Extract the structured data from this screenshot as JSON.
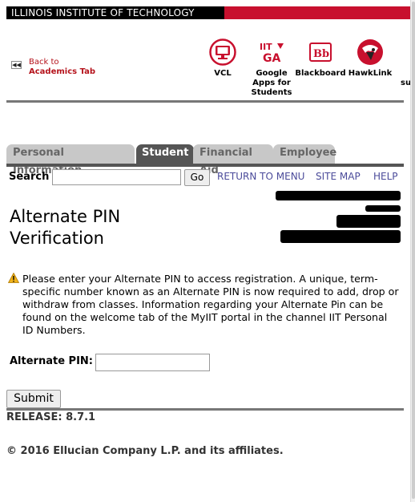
{
  "banner": {
    "title": "ILLINOIS INSTITUTE OF TECHNOLOGY",
    "black": "#000000",
    "red": "#c8102e"
  },
  "back_link": {
    "line1": "Back to",
    "line2": "Academics Tab",
    "icon": "back-arrow-icon"
  },
  "quick_links": [
    {
      "label": "VCL",
      "icon": "monitor-icon"
    },
    {
      "label": "Google Apps for Students",
      "line1": "Google",
      "line2": "Apps for",
      "line3": "Students",
      "icon": "iit-ga-logo-icon"
    },
    {
      "label": "Blackboard",
      "icon": "blackboard-icon"
    },
    {
      "label": "HawkLink",
      "icon": "hawk-icon"
    },
    {
      "label": "su",
      "icon": "partial-icon"
    }
  ],
  "tabs": [
    {
      "label": "Personal Information",
      "active": false
    },
    {
      "label": "Student",
      "active": true
    },
    {
      "label": "Financial Aid",
      "active": false
    },
    {
      "label": "Employee",
      "active": false
    }
  ],
  "search": {
    "label": "Search",
    "value": "",
    "go_label": "Go"
  },
  "nav_links": {
    "return_to_menu": "RETURN TO MENU",
    "site_map": "SITE MAP",
    "help": "HELP"
  },
  "page": {
    "title_line1": "Alternate PIN",
    "title_line2": "Verification",
    "info_icon": "warning-icon",
    "info_message": "Please enter your Alternate PIN to access registration. A unique, term-specific number known as an Alternate PIN is now required to add, drop or withdraw from classes. Information regarding your Alternate Pin can be found on the welcome tab of the MyIIT portal in the channel IIT Personal ID Numbers."
  },
  "form": {
    "pin_label": "Alternate PIN:",
    "pin_value": "",
    "submit_label": "Submit"
  },
  "footer": {
    "release": "RELEASE: 8.7.1",
    "copyright": "© 2016 Ellucian Company L.P. and its affiliates."
  },
  "colors": {
    "link": "#4b4b9a",
    "back_link": "#b5121b",
    "tab_inactive": "#c8c8c8",
    "tab_active": "#555555"
  }
}
